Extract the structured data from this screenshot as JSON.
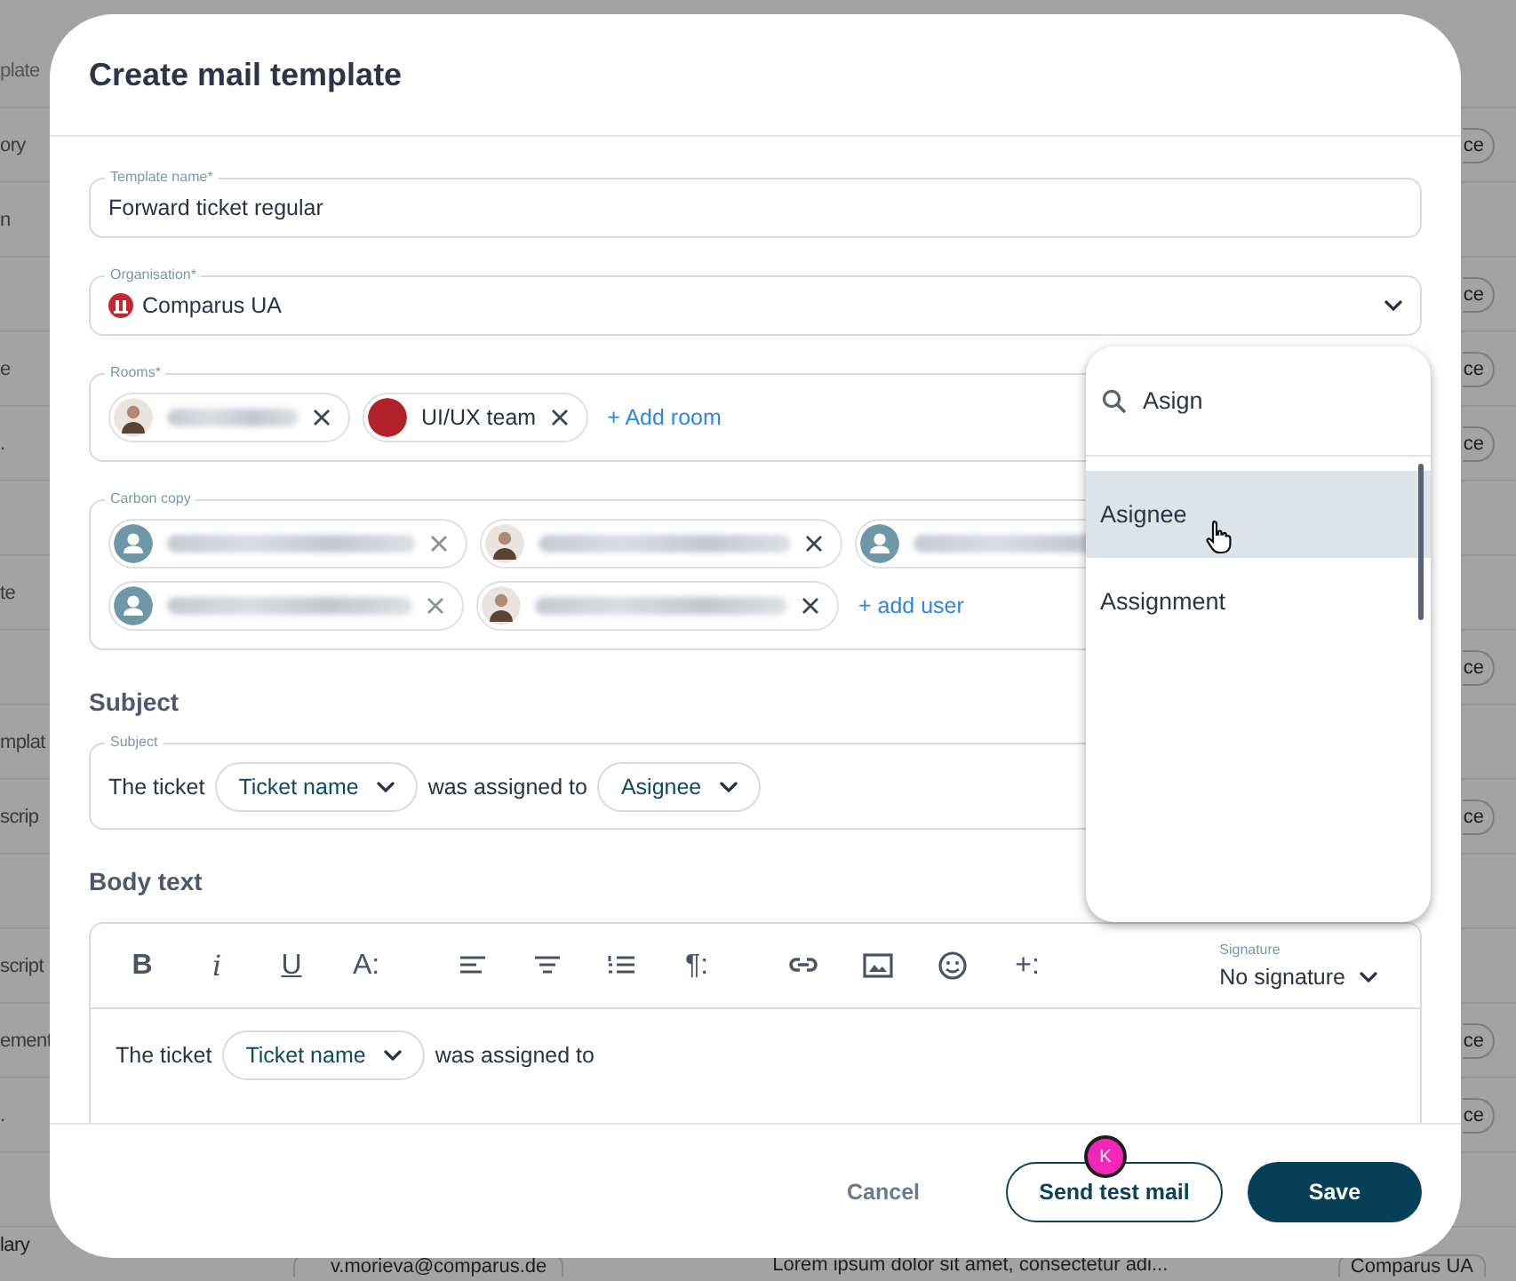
{
  "background": {
    "header": "plate",
    "rows": [
      {
        "cell": "ory",
        "badge": "ce"
      },
      {
        "cell": "n"
      },
      {
        "badge": "ce"
      },
      {
        "cell": "e",
        "badge": "ce"
      },
      {
        "cell": ".",
        "badge": "ce"
      },
      {},
      {
        "cell": "te"
      },
      {
        "badge": "ce"
      },
      {
        "cell": "mplat"
      },
      {
        "cell": "scrip",
        "badge": "ce"
      },
      {},
      {
        "cell": "script"
      },
      {
        "cell": "ement",
        "badge": "ce"
      },
      {
        "cell": ".",
        "badge": "ce"
      },
      {}
    ],
    "last_row": {
      "cell": "lary",
      "email": "v.morieva@comparus.de",
      "text": "Lorem ipsum dolor sit amet, consectetur adi...",
      "organisation": "Comparus UA"
    }
  },
  "dialog": {
    "title": "Create mail template",
    "template_name": {
      "label": "Template name*",
      "value": "Forward ticket regular"
    },
    "organisation": {
      "label": "Organisation*",
      "value": "Comparus UA"
    },
    "rooms": {
      "label": "Rooms*",
      "chips": [
        {
          "kind": "photo",
          "removable": true
        },
        {
          "kind": "logo",
          "name": "UI/UX team",
          "removable": true
        }
      ],
      "add_link": "+ Add room"
    },
    "carbon_copy": {
      "label": "Carbon copy",
      "chips": [
        {
          "kind": "generic",
          "removable": true
        },
        {
          "kind": "photo",
          "removable": true
        },
        {
          "kind": "generic"
        },
        {
          "kind": "generic",
          "removable": true
        },
        {
          "kind": "photo",
          "removable": true
        }
      ],
      "add_link": "+ add user"
    },
    "subject": {
      "heading": "Subject",
      "label": "Subject",
      "segments": [
        {
          "kind": "text",
          "text": "The ticket"
        },
        {
          "kind": "variable",
          "text": "Ticket name"
        },
        {
          "kind": "text",
          "text": "was assigned to"
        },
        {
          "kind": "variable",
          "text": "Asignee"
        }
      ]
    },
    "body": {
      "heading": "Body text",
      "toolbar": [
        {
          "kind": "bold",
          "label": "B"
        },
        {
          "kind": "italic",
          "label": "i"
        },
        {
          "kind": "underline",
          "label": "U"
        },
        {
          "kind": "font",
          "label": "A:"
        },
        {
          "kind": "align-left"
        },
        {
          "kind": "align-center"
        },
        {
          "kind": "numbered-list"
        },
        {
          "kind": "paragraph",
          "label": "¶:"
        },
        {
          "kind": "link"
        },
        {
          "kind": "image"
        },
        {
          "kind": "emoji"
        },
        {
          "kind": "insert",
          "label": "+:"
        }
      ],
      "signature": {
        "label": "Signature",
        "value": "No signature"
      },
      "segments": [
        {
          "kind": "text",
          "text": "The ticket"
        },
        {
          "kind": "variable",
          "text": "Ticket name"
        },
        {
          "kind": "text",
          "text": "was assigned to"
        }
      ]
    },
    "buttons": [
      {
        "kind": "text",
        "label": "Cancel"
      },
      {
        "kind": "outlined",
        "label": "Send test mail"
      },
      {
        "kind": "primary",
        "label": "Save"
      }
    ],
    "cursor_badge": "K"
  },
  "dropdown": {
    "search": "Asign",
    "options": [
      {
        "label": "Asignee",
        "selected": true
      },
      {
        "label": "Assignment",
        "selected": false
      }
    ]
  }
}
